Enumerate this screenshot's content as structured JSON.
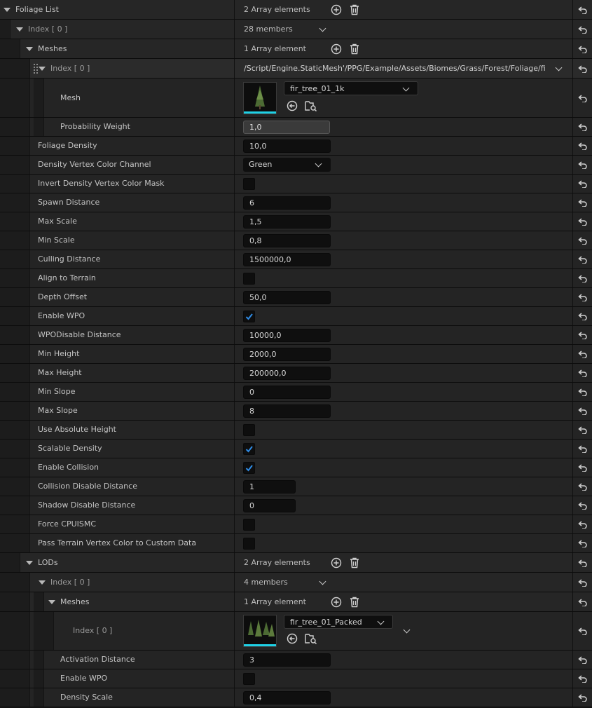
{
  "foliage_list": {
    "label": "Foliage List",
    "summary": "2 Array elements"
  },
  "index0": {
    "label": "Index [ 0 ]",
    "summary": "28 members"
  },
  "meshes": {
    "label": "Meshes",
    "summary": "1 Array element"
  },
  "mesh_index0": {
    "label": "Index [ 0 ]",
    "path": "/Script/Engine.StaticMesh'/PPG/Example/Assets/Biomes/Grass/Forest/Foliage/fir_"
  },
  "mesh": {
    "label": "Mesh",
    "asset": "fir_tree_01_1k"
  },
  "probability_weight": {
    "label": "Probability Weight",
    "value": "1,0"
  },
  "properties": [
    {
      "label": "Foliage Density",
      "kind": "field",
      "value": "10,0"
    },
    {
      "label": "Density Vertex Color Channel",
      "kind": "combo",
      "value": "Green"
    },
    {
      "label": "Invert Density Vertex Color Mask",
      "kind": "check",
      "checked": false
    },
    {
      "label": "Spawn Distance",
      "kind": "field",
      "value": "6"
    },
    {
      "label": "Max Scale",
      "kind": "field",
      "value": "1,5"
    },
    {
      "label": "Min Scale",
      "kind": "field",
      "value": "0,8"
    },
    {
      "label": "Culling Distance",
      "kind": "field",
      "value": "1500000,0"
    },
    {
      "label": "Align to Terrain",
      "kind": "check",
      "checked": false
    },
    {
      "label": "Depth Offset",
      "kind": "field",
      "value": "50,0"
    },
    {
      "label": "Enable WPO",
      "kind": "check",
      "checked": true
    },
    {
      "label": "WPODisable Distance",
      "kind": "field",
      "value": "10000,0"
    },
    {
      "label": "Min Height",
      "kind": "field",
      "value": "2000,0"
    },
    {
      "label": "Max Height",
      "kind": "field",
      "value": "200000,0"
    },
    {
      "label": "Min Slope",
      "kind": "field",
      "value": "0"
    },
    {
      "label": "Max Slope",
      "kind": "field",
      "value": "8"
    },
    {
      "label": "Use Absolute Height",
      "kind": "check",
      "checked": false
    },
    {
      "label": "Scalable Density",
      "kind": "check",
      "checked": true
    },
    {
      "label": "Enable Collision",
      "kind": "check",
      "checked": true
    },
    {
      "label": "Collision Disable Distance",
      "kind": "shortfield",
      "value": "1"
    },
    {
      "label": "Shadow Disable Distance",
      "kind": "shortfield",
      "value": "0"
    },
    {
      "label": "Force CPUISMC",
      "kind": "check",
      "checked": false
    },
    {
      "label": "Pass Terrain Vertex Color to Custom Data",
      "kind": "check",
      "checked": false
    }
  ],
  "lods": {
    "label": "LODs",
    "summary": "2 Array elements"
  },
  "lod_index0": {
    "label": "Index [ 0 ]",
    "summary": "4 members"
  },
  "lod_meshes": {
    "label": "Meshes",
    "summary": "1 Array element"
  },
  "lod_mesh_index0": {
    "label": "Index [ 0 ]",
    "asset": "fir_tree_01_Packed"
  },
  "lod_props": [
    {
      "label": "Activation Distance",
      "kind": "field",
      "value": "3"
    },
    {
      "label": "Enable WPO",
      "kind": "check",
      "checked": false
    },
    {
      "label": "Density Scale",
      "kind": "field",
      "value": "0,4"
    }
  ],
  "colors": {
    "accent": "#1fd1e6",
    "check": "#2f8ce6",
    "panel": "#242424",
    "field": "#0f0f0f"
  }
}
